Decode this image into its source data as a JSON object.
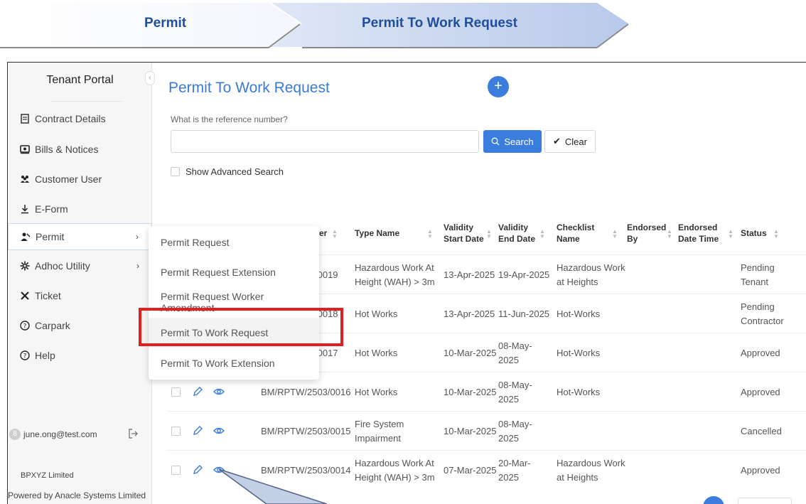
{
  "breadcrumb": {
    "step1": "Permit",
    "step2": "Permit To Work Request"
  },
  "sidebar": {
    "title": "Tenant Portal",
    "items": [
      {
        "label": "Contract Details",
        "icon": "contract-icon"
      },
      {
        "label": "Bills & Notices",
        "icon": "bills-icon"
      },
      {
        "label": "Customer User",
        "icon": "users-icon"
      },
      {
        "label": "E-Form",
        "icon": "download-icon"
      },
      {
        "label": "Permit",
        "icon": "permit-icon",
        "active": true
      },
      {
        "label": "Adhoc Utility",
        "icon": "utility-icon"
      },
      {
        "label": "Ticket",
        "icon": "tools-icon"
      },
      {
        "label": "Carpark",
        "icon": "help-circle-icon"
      },
      {
        "label": "Help",
        "icon": "help-circle-icon"
      }
    ],
    "user_email": "june.ong@test.com",
    "avatar_initial": "8",
    "company": "BPXYZ Limited",
    "powered_by": "Powered by Anacle Systems Limited"
  },
  "main": {
    "title": "Permit To Work Request",
    "reference_label": "What is the reference number?",
    "reference_value": "",
    "search_label": "Search",
    "clear_label": "Clear",
    "advanced_search_label": "Show Advanced Search"
  },
  "dropdown": {
    "items": [
      "Permit Request",
      "Permit Request Extension",
      "Permit Request Worker Amendment",
      "Permit To Work Request",
      "Permit To Work Extension"
    ],
    "selected": "Permit To Work Request"
  },
  "table": {
    "headers": {
      "number_suffix": "er",
      "type_name": "Type Name",
      "validity_start_1": "Validity",
      "validity_start_2": "Start Date",
      "validity_end_1": "Validity",
      "validity_end_2": "End Date",
      "checklist_1": "Checklist",
      "checklist_2": "Name",
      "endorsed_by_1": "Endorsed",
      "endorsed_by_2": "By",
      "endorsed_dt_1": "Endorsed",
      "endorsed_dt_2": "Date Time",
      "status": "Status"
    },
    "rows": [
      {
        "number": "/0019",
        "type_1": "Hazardous Work At",
        "type_2": "Height (WAH) > 3m",
        "start": "13-Apr-2025",
        "end_1": "19-Apr-2025",
        "end_2": "",
        "checklist_1": "Hazardous Work",
        "checklist_2": "at Heights",
        "status_1": "Pending",
        "status_2": "Tenant"
      },
      {
        "number": "/0018",
        "type_1": "Hot Works",
        "type_2": "",
        "start": "13-Apr-2025",
        "end_1": "11-Jun-2025",
        "end_2": "",
        "checklist_1": "Hot-Works",
        "checklist_2": "",
        "status_1": "Pending",
        "status_2": "Contractor"
      },
      {
        "number": "/0017",
        "type_1": "Hot Works",
        "type_2": "",
        "start": "10-Mar-2025",
        "end_1": "08-May-",
        "end_2": "2025",
        "checklist_1": "Hot-Works",
        "checklist_2": "",
        "status_1": "Approved",
        "status_2": ""
      },
      {
        "number": "BM/RPTW/2503/0016",
        "type_1": "Hot Works",
        "type_2": "",
        "start": "10-Mar-2025",
        "end_1": "08-May-",
        "end_2": "2025",
        "checklist_1": "Hot-Works",
        "checklist_2": "",
        "status_1": "Approved",
        "status_2": ""
      },
      {
        "number": "BM/RPTW/2503/0015",
        "type_1": "Fire System",
        "type_2": "Impairment",
        "start": "10-Mar-2025",
        "end_1": "08-May-",
        "end_2": "2025",
        "checklist_1": "",
        "checklist_2": "",
        "status_1": "Cancelled",
        "status_2": ""
      },
      {
        "number": "BM/RPTW/2503/0014",
        "type_1": "Hazardous Work At",
        "type_2": "Height (WAH) > 3m",
        "start": "07-Mar-2025",
        "end_1": "20-Mar-",
        "end_2": "2025",
        "checklist_1": "Hazardous Work",
        "checklist_2": "at Heights",
        "status_1": "Approved",
        "status_2": ""
      }
    ]
  },
  "colors": {
    "accent": "#3b7ddd",
    "title": "#3a7bd5",
    "banner_text": "#1f4e9c",
    "highlight": "#e02020"
  }
}
